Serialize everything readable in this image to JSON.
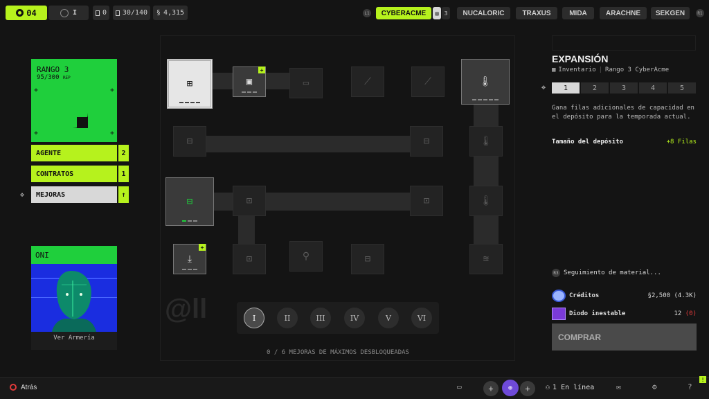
{
  "topbar": {
    "level": "04",
    "tier": "I",
    "stat_a": "0",
    "stat_b": "30/140",
    "stat_c": "4,315",
    "left_kbd": "L1",
    "right_kbd": "R1",
    "factions": [
      {
        "label": "CYBERACME",
        "badge": "3",
        "active": true
      },
      {
        "label": "NUCALORIC"
      },
      {
        "label": "TRAXUS"
      },
      {
        "label": "MIDA"
      },
      {
        "label": "ARACHNE"
      },
      {
        "label": "SEKGEN"
      }
    ]
  },
  "rank": {
    "title": "RANGO 3",
    "rep": "95/300",
    "rep_unit": "REP"
  },
  "sidebar": {
    "items": [
      {
        "label": "AGENTE",
        "count": "2"
      },
      {
        "label": "CONTRATOS",
        "count": "1"
      },
      {
        "label": "MEJORAS",
        "count": "↑",
        "selected": true
      }
    ]
  },
  "oni": {
    "title": "ONI",
    "link": "Ver Armería"
  },
  "tree": {
    "roman": [
      "I",
      "II",
      "III",
      "IV",
      "V",
      "VI"
    ],
    "selected_roman": "I",
    "progress_text": "0 / 6 MEJORAS DE MÁXIMOS DESBLOQUEADAS"
  },
  "detail": {
    "title": "EXPANSIÓN",
    "category": "Inventario",
    "rank_req": "Rango 3 CyberAcme",
    "ranks": [
      "1",
      "2",
      "3",
      "4",
      "5"
    ],
    "description": "Gana filas adicionales de capacidad en el depósito para la temporada actual.",
    "stat_label": "Tamaño del depósito",
    "stat_value": "+8 Filas",
    "tracking_kbd": "R3",
    "tracking_label": "Seguimiento de material...",
    "costs": [
      {
        "name": "Créditos",
        "value": "2,500 (4.3K)"
      },
      {
        "name": "Diodo inestable",
        "value": "12",
        "owned": "(0)"
      }
    ],
    "buy_label": "COMPRAR"
  },
  "bottombar": {
    "back": "Atrás",
    "online": "1 En línea",
    "help": "?"
  },
  "colors": {
    "accent": "#b6f21d",
    "rank_green": "#1fcf3c",
    "danger": "#e03a3a"
  }
}
